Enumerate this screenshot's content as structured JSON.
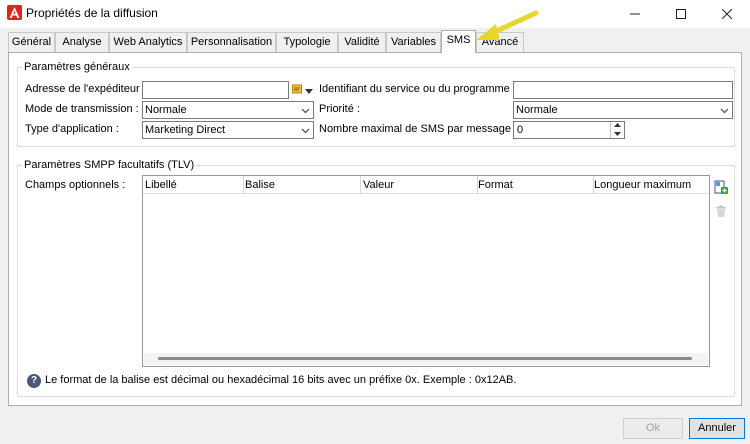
{
  "window": {
    "title": "Propriétés de la diffusion",
    "icon": "adobe-app-icon"
  },
  "tabs": [
    {
      "label": "Général"
    },
    {
      "label": "Analyse"
    },
    {
      "label": "Web Analytics"
    },
    {
      "label": "Personnalisation"
    },
    {
      "label": "Typologie"
    },
    {
      "label": "Validité"
    },
    {
      "label": "Variables"
    },
    {
      "label": "SMS",
      "active": true
    },
    {
      "label": "Avancé"
    }
  ],
  "general_params": {
    "legend": "Paramètres généraux",
    "sender_label": "Adresse de l'expéditeur :",
    "sender_value": "",
    "service_id_label": "Identifiant du service ou du programme :",
    "service_id_value": "",
    "transmission_label": "Mode de transmission :",
    "transmission_value": "Normale",
    "priority_label": "Priorité :",
    "priority_value": "Normale",
    "app_type_label": "Type d'application :",
    "app_type_value": "Marketing Direct",
    "max_sms_label": "Nombre maximal de SMS par message :",
    "max_sms_value": "0"
  },
  "smpp_params": {
    "legend": "Paramètres SMPP facultatifs (TLV)",
    "optional_fields_label": "Champs optionnels :",
    "columns": [
      "Libellé",
      "Balise",
      "Valeur",
      "Format",
      "Longueur maximum"
    ],
    "rows": []
  },
  "info": {
    "text": "Le format de la balise est décimal ou hexadécimal 16 bits avec un préfixe 0x. Exemple : 0x12AB."
  },
  "footer": {
    "ok_label": "Ok",
    "cancel_label": "Annuler"
  },
  "colors": {
    "accent": "#0078d7",
    "brand": "#e2231a",
    "annotation_arrow": "#e7d62b"
  }
}
